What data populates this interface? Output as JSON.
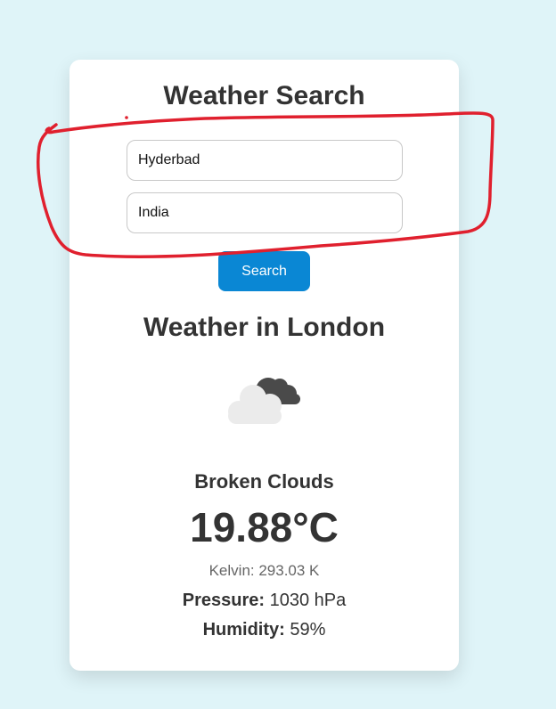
{
  "search": {
    "title": "Weather Search",
    "city_value": "Hyderbad",
    "country_value": "India",
    "button_label": "Search"
  },
  "weather": {
    "heading": "Weather in London",
    "icon": "broken-clouds-icon",
    "description": "Broken Clouds",
    "temperature": "19.88°C",
    "kelvin": "Kelvin: 293.03 K",
    "pressure_label": "Pressure:",
    "pressure_value": "1030 hPa",
    "humidity_label": "Humidity:",
    "humidity_value": "59%"
  },
  "colors": {
    "page_background": "#dff4f8",
    "card_background": "#ffffff",
    "button_background": "#0a87d4",
    "annotation": "#e0202e"
  }
}
